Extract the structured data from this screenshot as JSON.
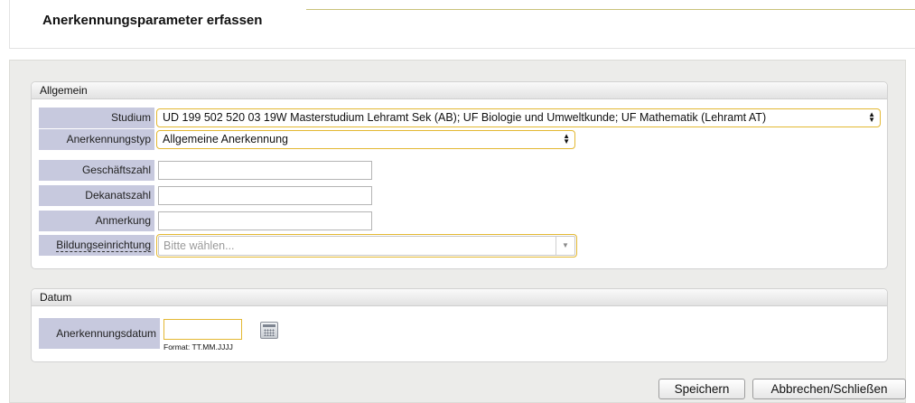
{
  "page": {
    "title": "Anerkennungsparameter erfassen"
  },
  "allgemein": {
    "legend": "Allgemein",
    "studium": {
      "label": "Studium",
      "value": "UD 199 502 520 03 19W Masterstudium Lehramt Sek (AB); UF Biologie und Umweltkunde; UF Mathematik (Lehramt AT)"
    },
    "anerkennungstyp": {
      "label": "Anerkennungstyp",
      "value": "Allgemeine Anerkennung"
    },
    "geschaeftszahl": {
      "label": "Geschäftszahl",
      "value": ""
    },
    "dekanatszahl": {
      "label": "Dekanatszahl",
      "value": ""
    },
    "anmerkung": {
      "label": "Anmerkung",
      "value": ""
    },
    "bildungseinrichtung": {
      "label": "Bildungseinrichtung",
      "placeholder": "Bitte wählen..."
    }
  },
  "datum": {
    "legend": "Datum",
    "anerkennungsdatum": {
      "label": "Anerkennungsdatum",
      "value": "",
      "format_hint": "Format: TT.MM.JJJJ"
    },
    "calendar_icon": "calendar-icon"
  },
  "buttons": {
    "save": "Speichern",
    "cancel": "Abbrechen/Schließen"
  },
  "colors": {
    "label_background": "#c7c9de",
    "focus_border": "#e3b832",
    "panel_background": "#ececea"
  }
}
